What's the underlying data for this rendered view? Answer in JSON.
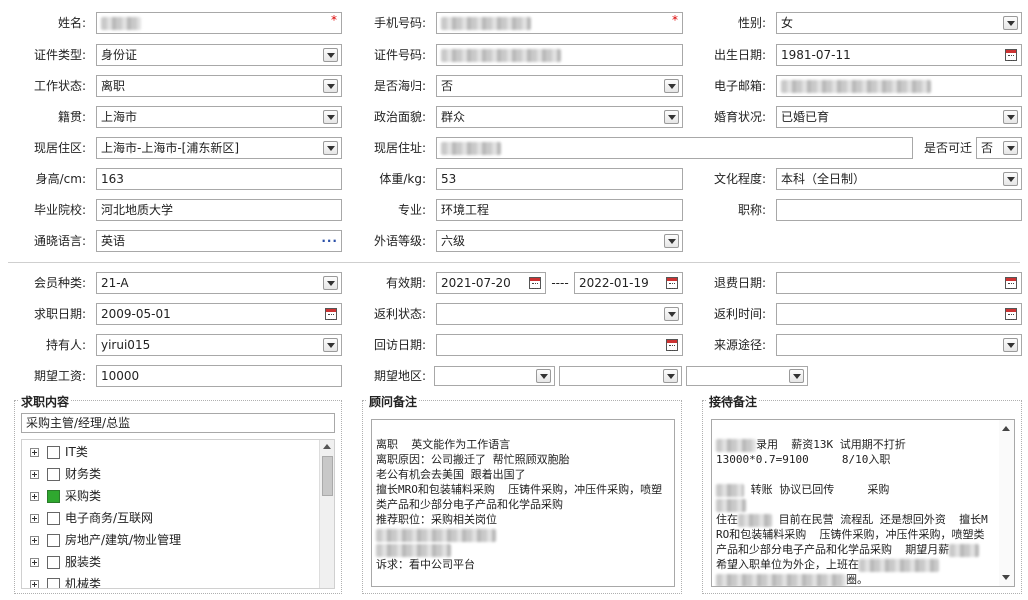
{
  "row1": {
    "name_label": "姓名:",
    "phone_label": "手机号码:",
    "gender_label": "性别:",
    "gender_value": "女",
    "required_mark": "*"
  },
  "row2": {
    "idtype_label": "证件类型:",
    "idtype_value": "身份证",
    "idno_label": "证件号码:",
    "birth_label": "出生日期:",
    "birth_value": "1981-07-11"
  },
  "row3": {
    "work_label": "工作状态:",
    "work_value": "离职",
    "overseas_label": "是否海归:",
    "overseas_value": "否",
    "email_label": "电子邮箱:"
  },
  "row4": {
    "native_label": "籍贯:",
    "native_value": "上海市",
    "political_label": "政治面貌:",
    "political_value": "群众",
    "marital_label": "婚育状况:",
    "marital_value": "已婚已育"
  },
  "row5": {
    "area_label": "现居住区:",
    "area_value": "上海市-上海市-[浦东新区]",
    "addr_label": "现居住址:",
    "relocate_label": "是否可迁",
    "relocate_value": "否"
  },
  "row6": {
    "height_label": "身高/cm:",
    "height_value": "163",
    "weight_label": "体重/kg:",
    "weight_value": "53",
    "edu_label": "文化程度:",
    "edu_value": "本科（全日制）"
  },
  "row7": {
    "school_label": "毕业院校:",
    "school_value": "河北地质大学",
    "major_label": "专业:",
    "major_value": "环境工程",
    "title_label": "职称:"
  },
  "row8": {
    "lang_label": "通晓语言:",
    "lang_value": "英语",
    "level_label": "外语等级:",
    "level_value": "六级"
  },
  "row9": {
    "member_label": "会员种类:",
    "member_value": "21-A",
    "valid_label": "有效期:",
    "valid_from": "2021-07-20",
    "valid_sep": "----",
    "valid_to": "2022-01-19",
    "refund_label": "退费日期:"
  },
  "row10": {
    "jobdate_label": "求职日期:",
    "jobdate_value": "2009-05-01",
    "rebate_state_label": "返利状态:",
    "rebate_time_label": "返利时间:"
  },
  "row11": {
    "holder_label": "持有人:",
    "holder_value": "yirui015",
    "visit_label": "回访日期:",
    "source_label": "来源途径:"
  },
  "row12": {
    "salary_label": "期望工资:",
    "salary_value": "10000",
    "region_label": "期望地区:"
  },
  "job_panel": {
    "title": "求职内容",
    "selected": "采购主管/经理/总监",
    "items": [
      {
        "label": "IT类",
        "checked": false
      },
      {
        "label": "财务类",
        "checked": false
      },
      {
        "label": "采购类",
        "checked": true
      },
      {
        "label": "电子商务/互联网",
        "checked": false
      },
      {
        "label": "房地产/建筑/物业管理",
        "checked": false
      },
      {
        "label": "服装类",
        "checked": false
      },
      {
        "label": "机械类",
        "checked": false
      }
    ]
  },
  "advisor_panel": {
    "title": "顾问备注",
    "lines": [
      "离职  英文能作为工作语言",
      "离职原因：公司搬迁了 帮忙照顾双胞胎",
      "老公有机会去美国 跟着出国了",
      "擅长MRO和包装辅料采购  压铸件采购，冲压件采购，喷塑类产品和少部分电子产品和化学品采购",
      "推荐职位：采购相关岗位",
      "",
      "",
      "诉求：看中公司平台"
    ]
  },
  "reception_panel": {
    "title": "接待备注",
    "l1": "录用  薪资13K 试用期不打折",
    "l2": "13000*0.7=9100     8/10入职",
    "l3": "转账 协议已回传     采购",
    "l4a": "住在",
    "l4b": " 目前在民营 流程乱 还是想回外资  擅长MRO和包装辅料采购  压铸件采购，冲压件采购，喷塑类产品和少部分电子产品和化学品采购  期望月薪",
    "l4c": " 希望入职单位为外企，上班在",
    "l5": "圈。"
  }
}
